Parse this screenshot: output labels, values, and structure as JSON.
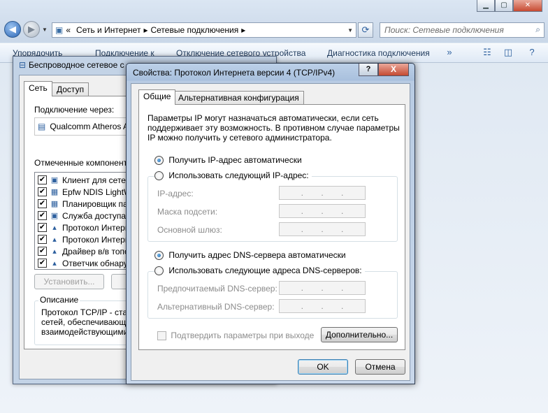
{
  "explorer": {
    "breadcrumb": [
      "Сеть и Интернет",
      "Сетевые подключения"
    ],
    "breadcrumb_prefix": "«",
    "search_placeholder": "Поиск: Сетевые подключения",
    "toolbar": [
      "Упорядочить",
      "Подключение к",
      "Отключение сетевого устройства",
      "Диагностика подключения"
    ]
  },
  "adapter_window": {
    "title": "Беспроводное сетевое с",
    "tabs": [
      "Сеть",
      "Доступ"
    ],
    "connect_using_label": "Подключение через:",
    "adapter_name": "Qualcomm Atheros AR",
    "components_label": "Отмеченные компоненты и",
    "components": [
      {
        "label": "Клиент для сетей",
        "checked": true,
        "icon": "network-client-icon"
      },
      {
        "label": "Epfw NDIS LightW",
        "checked": true,
        "icon": "network-service-icon"
      },
      {
        "label": "Планировщик пак",
        "checked": true,
        "icon": "network-service-icon"
      },
      {
        "label": "Служба доступа к",
        "checked": true,
        "icon": "network-client-icon"
      },
      {
        "label": "Протокол Интерне",
        "checked": true,
        "icon": "protocol-icon"
      },
      {
        "label": "Протокол Интерне",
        "checked": true,
        "icon": "protocol-icon"
      },
      {
        "label": "Драйвер в/в топо",
        "checked": true,
        "icon": "protocol-icon"
      },
      {
        "label": "Ответчик обнаруж",
        "checked": true,
        "icon": "protocol-icon"
      }
    ],
    "install_button": "Установить...",
    "description_label": "Описание",
    "description_lines": [
      "Протокол TCP/IP - станд",
      "сетей, обеспечивающий",
      "взаимодействующими с"
    ]
  },
  "ipv4_dialog": {
    "title": "Свойства: Протокол Интернета версии 4 (TCP/IPv4)",
    "tabs": [
      "Общие",
      "Альтернативная конфигурация"
    ],
    "intro": [
      "Параметры IP могут назначаться автоматически, если сеть",
      "поддерживает эту возможность. В противном случае параметры",
      "IP можно получить у сетевого администратора."
    ],
    "ip_auto": "Получить IP-адрес автоматически",
    "ip_manual": "Использовать следующий IP-адрес:",
    "ip_fields": [
      "IP-адрес:",
      "Маска подсети:",
      "Основной шлюз:"
    ],
    "dns_auto": "Получить адрес DNS-сервера автоматически",
    "dns_manual": "Использовать следующие адреса DNS-серверов:",
    "dns_fields": [
      "Предпочитаемый DNS-сервер:",
      "Альтернативный DNS-сервер:"
    ],
    "validate_label": "Подтвердить параметры при выходе",
    "advanced_button": "Дополнительно...",
    "ok_button": "OK",
    "cancel_button": "Отмена",
    "help_button": "?",
    "close_button": "X",
    "ip_dot": "."
  }
}
